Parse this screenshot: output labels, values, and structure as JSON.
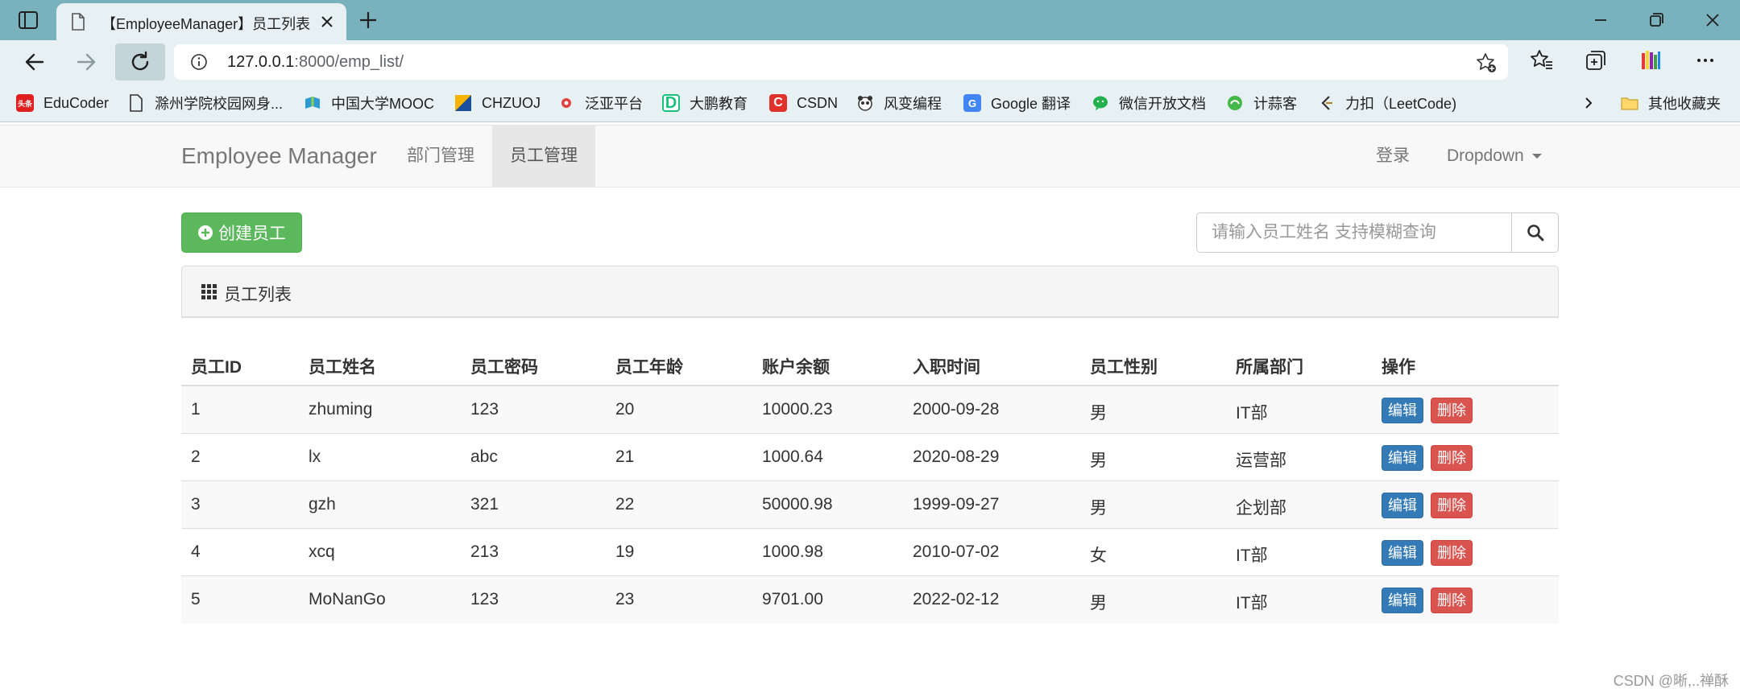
{
  "browser": {
    "tab_title": "【EmployeeManager】员工列表",
    "url_host": "127.0.0.1",
    "url_rest": ":8000/emp_list/"
  },
  "bookmarks": [
    {
      "label": "EduCoder",
      "icon": "toutiao-icon",
      "color": "#e02020",
      "glyph": "头条"
    },
    {
      "label": "滁州学院校园网身...",
      "icon": "page-icon",
      "color": "#ffffff",
      "glyph": ""
    },
    {
      "label": "中国大学MOOC",
      "icon": "mooc-icon",
      "color": "#2d9bd2",
      "glyph": ""
    },
    {
      "label": "CHZUOJ",
      "icon": "chzuoj-icon",
      "color": "#f4b400",
      "glyph": ""
    },
    {
      "label": "泛亚平台",
      "icon": "fanya-icon",
      "color": "#e04040",
      "glyph": ""
    },
    {
      "label": "大鹏教育",
      "icon": "dapeng-icon",
      "color": "#19c37d",
      "glyph": "D"
    },
    {
      "label": "CSDN",
      "icon": "csdn-icon",
      "color": "#e0312a",
      "glyph": "C"
    },
    {
      "label": "风变编程",
      "icon": "panda-icon",
      "color": "#444444",
      "glyph": ""
    },
    {
      "label": "Google 翻译",
      "icon": "google-translate-icon",
      "color": "#4285f4",
      "glyph": "G"
    },
    {
      "label": "微信开放文档",
      "icon": "wechat-icon",
      "color": "#22b14c",
      "glyph": ""
    },
    {
      "label": "计蒜客",
      "icon": "jisuanke-icon",
      "color": "#46b749",
      "glyph": ""
    },
    {
      "label": "力扣（LeetCode)",
      "icon": "leetcode-icon",
      "color": "#b3852f",
      "glyph": ""
    }
  ],
  "other_bookmarks": "其他收藏夹",
  "navbar": {
    "brand": "Employee Manager",
    "links": [
      "部门管理",
      "员工管理"
    ],
    "login": "登录",
    "dropdown": "Dropdown"
  },
  "toolbar": {
    "create_label": "创建员工",
    "search_placeholder": "请输入员工姓名 支持模糊查询"
  },
  "panel": {
    "title": "员工列表"
  },
  "table": {
    "headers": [
      "员工ID",
      "员工姓名",
      "员工密码",
      "员工年龄",
      "账户余额",
      "入职时间",
      "员工性别",
      "所属部门",
      "操作"
    ],
    "rows": [
      [
        "1",
        "zhuming",
        "123",
        "20",
        "10000.23",
        "2000-09-28",
        "男",
        "IT部"
      ],
      [
        "2",
        "lx",
        "abc",
        "21",
        "1000.64",
        "2020-08-29",
        "男",
        "运营部"
      ],
      [
        "3",
        "gzh",
        "321",
        "22",
        "50000.98",
        "1999-09-27",
        "男",
        "企划部"
      ],
      [
        "4",
        "xcq",
        "213",
        "19",
        "1000.98",
        "2010-07-02",
        "女",
        "IT部"
      ],
      [
        "5",
        "MoNanGo",
        "123",
        "23",
        "9701.00",
        "2022-02-12",
        "男",
        "IT部"
      ]
    ],
    "edit_label": "编辑",
    "delete_label": "删除"
  },
  "watermark": "CSDN @晰,..禅酥"
}
